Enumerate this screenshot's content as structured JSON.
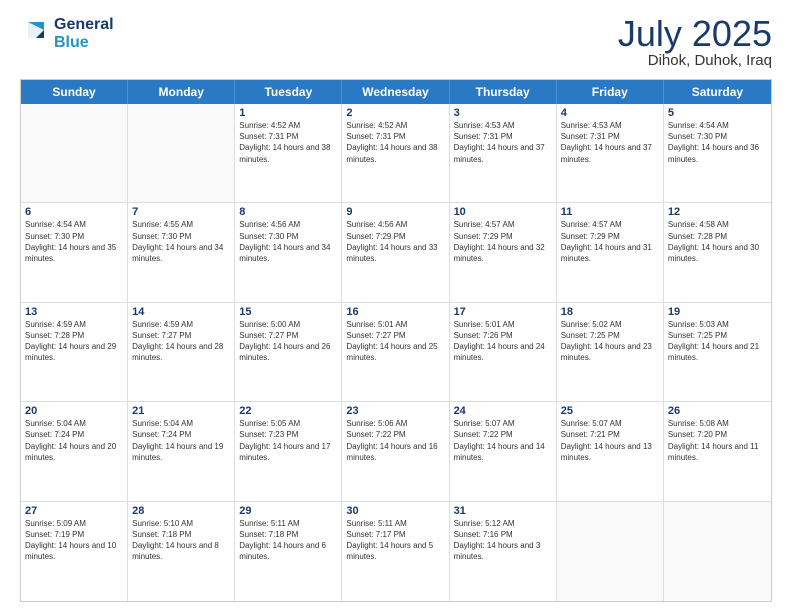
{
  "header": {
    "logo_line1": "General",
    "logo_line2": "Blue",
    "month": "July 2025",
    "location": "Dihok, Duhok, Iraq"
  },
  "weekdays": [
    "Sunday",
    "Monday",
    "Tuesday",
    "Wednesday",
    "Thursday",
    "Friday",
    "Saturday"
  ],
  "weeks": [
    [
      {
        "day": "",
        "sunrise": "",
        "sunset": "",
        "daylight": ""
      },
      {
        "day": "",
        "sunrise": "",
        "sunset": "",
        "daylight": ""
      },
      {
        "day": "1",
        "sunrise": "Sunrise: 4:52 AM",
        "sunset": "Sunset: 7:31 PM",
        "daylight": "Daylight: 14 hours and 38 minutes."
      },
      {
        "day": "2",
        "sunrise": "Sunrise: 4:52 AM",
        "sunset": "Sunset: 7:31 PM",
        "daylight": "Daylight: 14 hours and 38 minutes."
      },
      {
        "day": "3",
        "sunrise": "Sunrise: 4:53 AM",
        "sunset": "Sunset: 7:31 PM",
        "daylight": "Daylight: 14 hours and 37 minutes."
      },
      {
        "day": "4",
        "sunrise": "Sunrise: 4:53 AM",
        "sunset": "Sunset: 7:31 PM",
        "daylight": "Daylight: 14 hours and 37 minutes."
      },
      {
        "day": "5",
        "sunrise": "Sunrise: 4:54 AM",
        "sunset": "Sunset: 7:30 PM",
        "daylight": "Daylight: 14 hours and 36 minutes."
      }
    ],
    [
      {
        "day": "6",
        "sunrise": "Sunrise: 4:54 AM",
        "sunset": "Sunset: 7:30 PM",
        "daylight": "Daylight: 14 hours and 35 minutes."
      },
      {
        "day": "7",
        "sunrise": "Sunrise: 4:55 AM",
        "sunset": "Sunset: 7:30 PM",
        "daylight": "Daylight: 14 hours and 34 minutes."
      },
      {
        "day": "8",
        "sunrise": "Sunrise: 4:56 AM",
        "sunset": "Sunset: 7:30 PM",
        "daylight": "Daylight: 14 hours and 34 minutes."
      },
      {
        "day": "9",
        "sunrise": "Sunrise: 4:56 AM",
        "sunset": "Sunset: 7:29 PM",
        "daylight": "Daylight: 14 hours and 33 minutes."
      },
      {
        "day": "10",
        "sunrise": "Sunrise: 4:57 AM",
        "sunset": "Sunset: 7:29 PM",
        "daylight": "Daylight: 14 hours and 32 minutes."
      },
      {
        "day": "11",
        "sunrise": "Sunrise: 4:57 AM",
        "sunset": "Sunset: 7:29 PM",
        "daylight": "Daylight: 14 hours and 31 minutes."
      },
      {
        "day": "12",
        "sunrise": "Sunrise: 4:58 AM",
        "sunset": "Sunset: 7:28 PM",
        "daylight": "Daylight: 14 hours and 30 minutes."
      }
    ],
    [
      {
        "day": "13",
        "sunrise": "Sunrise: 4:59 AM",
        "sunset": "Sunset: 7:28 PM",
        "daylight": "Daylight: 14 hours and 29 minutes."
      },
      {
        "day": "14",
        "sunrise": "Sunrise: 4:59 AM",
        "sunset": "Sunset: 7:27 PM",
        "daylight": "Daylight: 14 hours and 28 minutes."
      },
      {
        "day": "15",
        "sunrise": "Sunrise: 5:00 AM",
        "sunset": "Sunset: 7:27 PM",
        "daylight": "Daylight: 14 hours and 26 minutes."
      },
      {
        "day": "16",
        "sunrise": "Sunrise: 5:01 AM",
        "sunset": "Sunset: 7:27 PM",
        "daylight": "Daylight: 14 hours and 25 minutes."
      },
      {
        "day": "17",
        "sunrise": "Sunrise: 5:01 AM",
        "sunset": "Sunset: 7:26 PM",
        "daylight": "Daylight: 14 hours and 24 minutes."
      },
      {
        "day": "18",
        "sunrise": "Sunrise: 5:02 AM",
        "sunset": "Sunset: 7:25 PM",
        "daylight": "Daylight: 14 hours and 23 minutes."
      },
      {
        "day": "19",
        "sunrise": "Sunrise: 5:03 AM",
        "sunset": "Sunset: 7:25 PM",
        "daylight": "Daylight: 14 hours and 21 minutes."
      }
    ],
    [
      {
        "day": "20",
        "sunrise": "Sunrise: 5:04 AM",
        "sunset": "Sunset: 7:24 PM",
        "daylight": "Daylight: 14 hours and 20 minutes."
      },
      {
        "day": "21",
        "sunrise": "Sunrise: 5:04 AM",
        "sunset": "Sunset: 7:24 PM",
        "daylight": "Daylight: 14 hours and 19 minutes."
      },
      {
        "day": "22",
        "sunrise": "Sunrise: 5:05 AM",
        "sunset": "Sunset: 7:23 PM",
        "daylight": "Daylight: 14 hours and 17 minutes."
      },
      {
        "day": "23",
        "sunrise": "Sunrise: 5:06 AM",
        "sunset": "Sunset: 7:22 PM",
        "daylight": "Daylight: 14 hours and 16 minutes."
      },
      {
        "day": "24",
        "sunrise": "Sunrise: 5:07 AM",
        "sunset": "Sunset: 7:22 PM",
        "daylight": "Daylight: 14 hours and 14 minutes."
      },
      {
        "day": "25",
        "sunrise": "Sunrise: 5:07 AM",
        "sunset": "Sunset: 7:21 PM",
        "daylight": "Daylight: 14 hours and 13 minutes."
      },
      {
        "day": "26",
        "sunrise": "Sunrise: 5:08 AM",
        "sunset": "Sunset: 7:20 PM",
        "daylight": "Daylight: 14 hours and 11 minutes."
      }
    ],
    [
      {
        "day": "27",
        "sunrise": "Sunrise: 5:09 AM",
        "sunset": "Sunset: 7:19 PM",
        "daylight": "Daylight: 14 hours and 10 minutes."
      },
      {
        "day": "28",
        "sunrise": "Sunrise: 5:10 AM",
        "sunset": "Sunset: 7:18 PM",
        "daylight": "Daylight: 14 hours and 8 minutes."
      },
      {
        "day": "29",
        "sunrise": "Sunrise: 5:11 AM",
        "sunset": "Sunset: 7:18 PM",
        "daylight": "Daylight: 14 hours and 6 minutes."
      },
      {
        "day": "30",
        "sunrise": "Sunrise: 5:11 AM",
        "sunset": "Sunset: 7:17 PM",
        "daylight": "Daylight: 14 hours and 5 minutes."
      },
      {
        "day": "31",
        "sunrise": "Sunrise: 5:12 AM",
        "sunset": "Sunset: 7:16 PM",
        "daylight": "Daylight: 14 hours and 3 minutes."
      },
      {
        "day": "",
        "sunrise": "",
        "sunset": "",
        "daylight": ""
      },
      {
        "day": "",
        "sunrise": "",
        "sunset": "",
        "daylight": ""
      }
    ]
  ]
}
